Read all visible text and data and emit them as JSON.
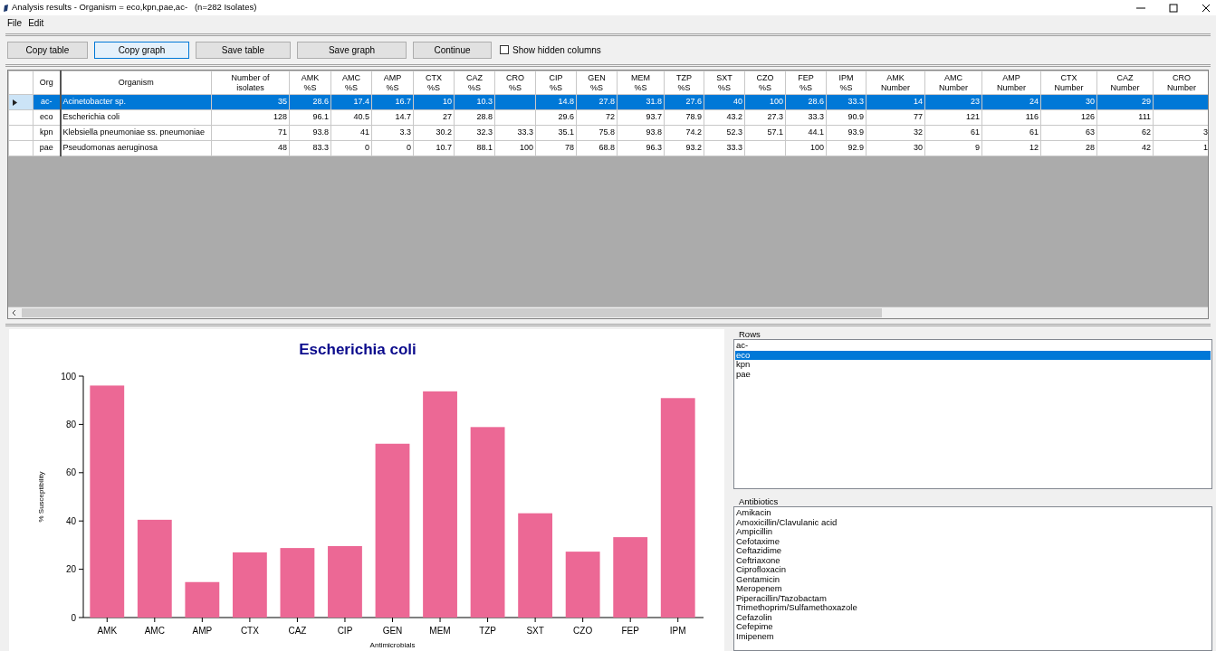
{
  "window": {
    "title": "Analysis results - Organism = eco,kpn,pae,ac-   (n=282 Isolates)"
  },
  "menu": [
    "File",
    "Edit"
  ],
  "toolbar": {
    "buttons": [
      {
        "label": "Copy table",
        "focused": false
      },
      {
        "label": "Copy graph",
        "focused": true
      },
      {
        "label": "Save table",
        "focused": false
      },
      {
        "label": "Save graph",
        "focused": false
      },
      {
        "label": "Continue",
        "focused": false
      }
    ],
    "checkbox": {
      "label": "Show hidden columns",
      "checked": false
    }
  },
  "table": {
    "columns": [
      "Org",
      "Organism",
      "Number of\nisolates",
      "AMK\n%S",
      "AMC\n%S",
      "AMP\n%S",
      "CTX\n%S",
      "CAZ\n%S",
      "CRO\n%S",
      "CIP\n%S",
      "GEN\n%S",
      "MEM\n%S",
      "TZP\n%S",
      "SXT\n%S",
      "CZO\n%S",
      "FEP\n%S",
      "IPM\n%S",
      "AMK\nNumber",
      "AMC\nNumber",
      "AMP\nNumber",
      "CTX\nNumber",
      "CAZ\nNumber",
      "CRO\nNumber"
    ],
    "rows": [
      {
        "selected": true,
        "cells": [
          "ac-",
          "Acinetobacter sp.",
          "35",
          "28.6",
          "17.4",
          "16.7",
          "10",
          "10.3",
          "",
          "14.8",
          "27.8",
          "31.8",
          "27.6",
          "40",
          "100",
          "28.6",
          "33.3",
          "14",
          "23",
          "24",
          "30",
          "29",
          ""
        ]
      },
      {
        "selected": false,
        "cells": [
          "eco",
          "Escherichia coli",
          "128",
          "96.1",
          "40.5",
          "14.7",
          "27",
          "28.8",
          "",
          "29.6",
          "72",
          "93.7",
          "78.9",
          "43.2",
          "27.3",
          "33.3",
          "90.9",
          "77",
          "121",
          "116",
          "126",
          "111",
          ""
        ]
      },
      {
        "selected": false,
        "cells": [
          "kpn",
          "Klebsiella pneumoniae ss. pneumoniae",
          "71",
          "93.8",
          "41",
          "3.3",
          "30.2",
          "32.3",
          "33.3",
          "35.1",
          "75.8",
          "93.8",
          "74.2",
          "52.3",
          "57.1",
          "44.1",
          "93.9",
          "32",
          "61",
          "61",
          "63",
          "62",
          "3"
        ]
      },
      {
        "selected": false,
        "cells": [
          "pae",
          "Pseudomonas aeruginosa",
          "48",
          "83.3",
          "0",
          "0",
          "10.7",
          "88.1",
          "100",
          "78",
          "68.8",
          "96.3",
          "93.2",
          "33.3",
          "",
          "100",
          "92.9",
          "30",
          "9",
          "12",
          "28",
          "42",
          "1"
        ]
      }
    ]
  },
  "chart": {
    "chart_data": {
      "type": "bar",
      "title": "Escherichia coli",
      "xlabel": "Antimicrobials",
      "ylabel": "% Susceptibility",
      "categories": [
        "AMK",
        "AMC",
        "AMP",
        "CTX",
        "CAZ",
        "CIP",
        "GEN",
        "MEM",
        "TZP",
        "SXT",
        "CZO",
        "FEP",
        "IPM"
      ],
      "series": [
        {
          "color": "#ec6895",
          "values": [
            96.1,
            40.5,
            14.7,
            27,
            28.8,
            29.6,
            72,
            93.7,
            78.9,
            43.2,
            27.3,
            33.3,
            90.9
          ]
        }
      ],
      "ylim": [
        0,
        100
      ],
      "yticks": [
        0,
        20,
        40,
        60,
        80,
        100
      ]
    }
  },
  "rows_panel": {
    "title": "Rows",
    "items": [
      {
        "label": "ac-",
        "selected": false
      },
      {
        "label": "eco",
        "selected": true
      },
      {
        "label": "kpn",
        "selected": false
      },
      {
        "label": "pae",
        "selected": false
      }
    ]
  },
  "antibiotics_panel": {
    "title": "Antibiotics",
    "items": [
      "Amikacin",
      "Amoxicillin/Clavulanic acid",
      "Ampicillin",
      "Cefotaxime",
      "Ceftazidime",
      "Ceftriaxone",
      "Ciprofloxacin",
      "Gentamicin",
      "Meropenem",
      "Piperacillin/Tazobactam",
      "Trimethoprim/Sulfamethoxazole",
      "Cefazolin",
      "Cefepime",
      "Imipenem"
    ]
  }
}
